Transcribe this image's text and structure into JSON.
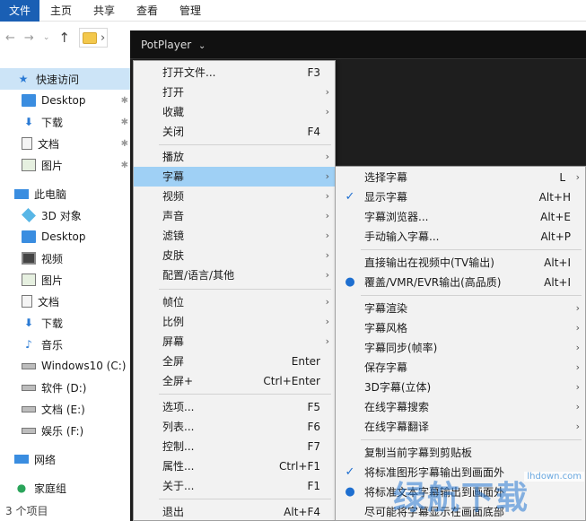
{
  "ribbon": {
    "tabs": [
      "文件",
      "主页",
      "共享",
      "查看",
      "管理"
    ]
  },
  "address": {
    "arrow": "›"
  },
  "sidebar": {
    "items": [
      {
        "label": "快速访问",
        "icon": "star-icon",
        "pinned": false
      },
      {
        "label": "Desktop",
        "icon": "desktop-icon",
        "pinned": true
      },
      {
        "label": "下载",
        "icon": "download-icon",
        "pinned": true
      },
      {
        "label": "文档",
        "icon": "document-icon",
        "pinned": true
      },
      {
        "label": "图片",
        "icon": "picture-icon",
        "pinned": true
      },
      {
        "label": "此电脑",
        "icon": "computer-icon",
        "pinned": false
      },
      {
        "label": "3D 对象",
        "icon": "3d-objects-icon",
        "pinned": false
      },
      {
        "label": "Desktop",
        "icon": "desktop-icon",
        "pinned": false
      },
      {
        "label": "视频",
        "icon": "video-icon",
        "pinned": false
      },
      {
        "label": "图片",
        "icon": "picture-icon",
        "pinned": false
      },
      {
        "label": "文档",
        "icon": "document-icon",
        "pinned": false
      },
      {
        "label": "下载",
        "icon": "download-icon",
        "pinned": false
      },
      {
        "label": "音乐",
        "icon": "music-icon",
        "pinned": false
      },
      {
        "label": "Windows10 (C:)",
        "icon": "drive-icon",
        "pinned": false
      },
      {
        "label": "软件 (D:)",
        "icon": "drive-icon",
        "pinned": false
      },
      {
        "label": "文档 (E:)",
        "icon": "drive-icon",
        "pinned": false
      },
      {
        "label": "娱乐 (F:)",
        "icon": "drive-icon",
        "pinned": false
      },
      {
        "label": "网络",
        "icon": "network-icon",
        "pinned": false
      },
      {
        "label": "家庭组",
        "icon": "homegroup-icon",
        "pinned": false
      }
    ],
    "status": "3 个项目"
  },
  "potplayer": {
    "title": "PotPlayer",
    "title_arrow": "⌄"
  },
  "main_menu": {
    "items": [
      {
        "label": "打开文件...",
        "shortcut": "F3",
        "submenu": false
      },
      {
        "label": "打开",
        "shortcut": "",
        "submenu": true
      },
      {
        "label": "收藏",
        "shortcut": "",
        "submenu": true
      },
      {
        "label": "关闭",
        "shortcut": "F4",
        "submenu": false
      },
      {
        "label": "播放",
        "shortcut": "",
        "submenu": true
      },
      {
        "label": "字幕",
        "shortcut": "",
        "submenu": true,
        "highlighted": true
      },
      {
        "label": "视频",
        "shortcut": "",
        "submenu": true
      },
      {
        "label": "声音",
        "shortcut": "",
        "submenu": true
      },
      {
        "label": "滤镜",
        "shortcut": "",
        "submenu": true
      },
      {
        "label": "皮肤",
        "shortcut": "",
        "submenu": true
      },
      {
        "label": "配置/语言/其他",
        "shortcut": "",
        "submenu": true
      },
      {
        "label": "帧位",
        "shortcut": "",
        "submenu": true
      },
      {
        "label": "比例",
        "shortcut": "",
        "submenu": true
      },
      {
        "label": "屏幕",
        "shortcut": "",
        "submenu": true
      },
      {
        "label": "全屏",
        "shortcut": "Enter",
        "submenu": false
      },
      {
        "label": "全屏+",
        "shortcut": "Ctrl+Enter",
        "submenu": false
      },
      {
        "label": "选项...",
        "shortcut": "F5",
        "submenu": false
      },
      {
        "label": "列表...",
        "shortcut": "F6",
        "submenu": false
      },
      {
        "label": "控制...",
        "shortcut": "F7",
        "submenu": false
      },
      {
        "label": "属性...",
        "shortcut": "Ctrl+F1",
        "submenu": false
      },
      {
        "label": "关于...",
        "shortcut": "F1",
        "submenu": false
      },
      {
        "label": "退出",
        "shortcut": "Alt+F4",
        "submenu": false
      }
    ]
  },
  "subtitle_menu": {
    "items": [
      {
        "label": "选择字幕",
        "shortcut": "L",
        "submenu": true,
        "mark": ""
      },
      {
        "label": "显示字幕",
        "shortcut": "Alt+H",
        "submenu": false,
        "mark": "✓"
      },
      {
        "label": "字幕浏览器...",
        "shortcut": "Alt+E",
        "submenu": false,
        "mark": ""
      },
      {
        "label": "手动输入字幕...",
        "shortcut": "Alt+P",
        "submenu": false,
        "mark": ""
      },
      {
        "label": "直接输出在视频中(TV输出)",
        "shortcut": "Alt+I",
        "submenu": false,
        "mark": ""
      },
      {
        "label": "覆盖/VMR/EVR输出(高品质)",
        "shortcut": "Alt+I",
        "submenu": false,
        "mark": "●"
      },
      {
        "label": "字幕渲染",
        "shortcut": "",
        "submenu": true,
        "mark": ""
      },
      {
        "label": "字幕风格",
        "shortcut": "",
        "submenu": true,
        "mark": ""
      },
      {
        "label": "字幕同步(帧率)",
        "shortcut": "",
        "submenu": true,
        "mark": ""
      },
      {
        "label": "保存字幕",
        "shortcut": "",
        "submenu": true,
        "mark": ""
      },
      {
        "label": "3D字幕(立体)",
        "shortcut": "",
        "submenu": true,
        "mark": ""
      },
      {
        "label": "在线字幕搜索",
        "shortcut": "",
        "submenu": true,
        "mark": ""
      },
      {
        "label": "在线字幕翻译",
        "shortcut": "",
        "submenu": true,
        "mark": ""
      },
      {
        "label": "复制当前字幕到剪贴板",
        "shortcut": "",
        "submenu": false,
        "mark": ""
      },
      {
        "label": "将标准图形字幕输出到画面外",
        "shortcut": "",
        "submenu": false,
        "mark": "✓"
      },
      {
        "label": "将标准文本字幕输出到画面外",
        "shortcut": "",
        "submenu": false,
        "mark": "●"
      },
      {
        "label": "尽可能将字幕显示在画面底部",
        "shortcut": "",
        "submenu": false,
        "mark": ""
      }
    ]
  },
  "watermark": {
    "text": "绿航下载",
    "url": "lhdown.com"
  },
  "arrow_glyph": "›"
}
